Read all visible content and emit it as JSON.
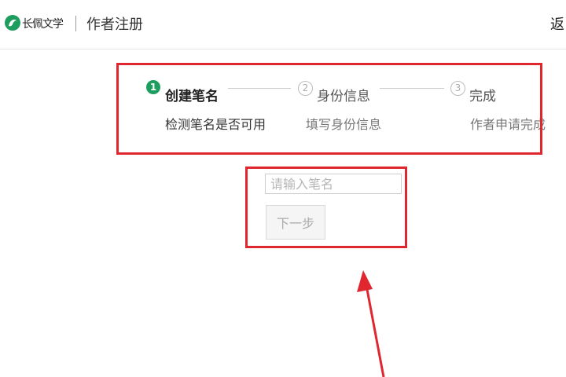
{
  "header": {
    "logo_text": "长佩文学",
    "title": "作者注册",
    "back_label": "返"
  },
  "steps": [
    {
      "number": "1",
      "title": "创建笔名",
      "desc": "检测笔名是否可用",
      "state": "active"
    },
    {
      "number": "2",
      "title": "身份信息",
      "desc": "填写身份信息",
      "state": "inactive"
    },
    {
      "number": "3",
      "title": "完成",
      "desc": "作者申请完成",
      "state": "inactive"
    }
  ],
  "form": {
    "name_placeholder": "请输入笔名",
    "name_value": "",
    "next_label": "下一步"
  },
  "colors": {
    "accent": "#1e9e5e",
    "highlight": "#e0262f"
  },
  "icons": {
    "logo": "changpei-logo-icon",
    "annotation": "red-arrow-icon"
  }
}
